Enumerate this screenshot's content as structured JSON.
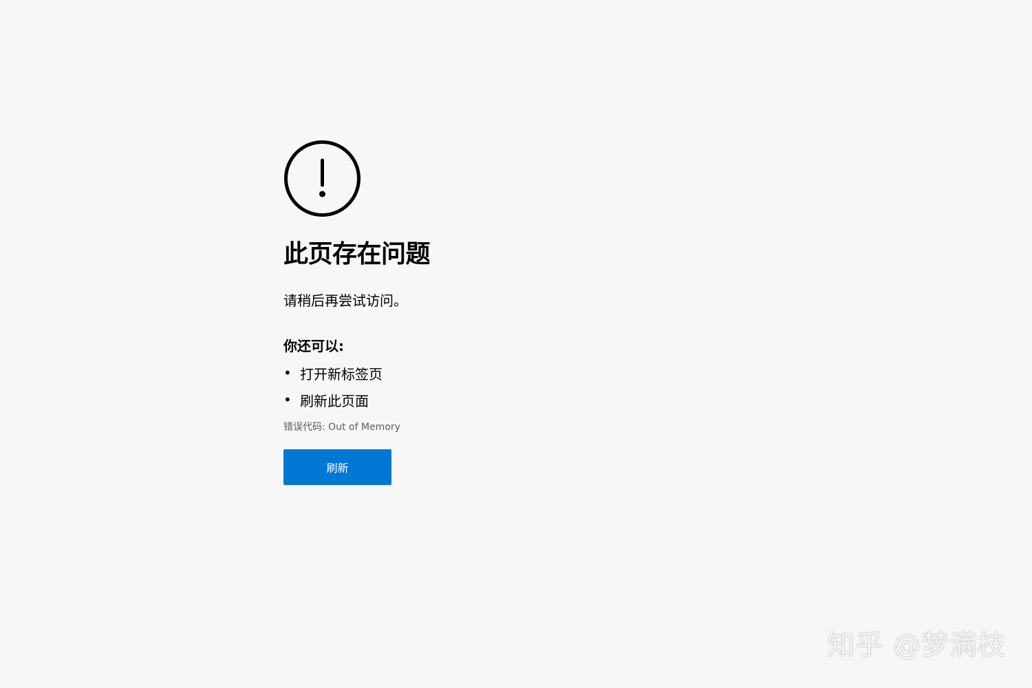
{
  "error_page": {
    "icon": "exclamation-circle-icon",
    "title": "此页存在问题",
    "subtitle": "请稍后再尝试访问。",
    "suggestions_heading": "你还可以:",
    "suggestions": [
      {
        "label": "打开新标签页"
      },
      {
        "label": "刷新此页面"
      }
    ],
    "error_code": "错误代码: Out of Memory",
    "refresh_button_label": "刷新"
  },
  "watermark": {
    "text": "知乎 @梦满枝"
  },
  "colors": {
    "background": "#f7f7f7",
    "button": "#0078d4",
    "button_text": "#ffffff",
    "error_code_text": "#5d5d5d"
  }
}
